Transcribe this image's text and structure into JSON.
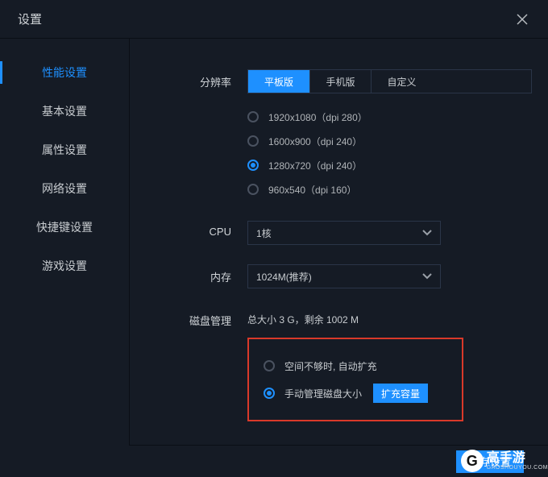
{
  "header": {
    "title": "设置"
  },
  "sidebar": {
    "items": [
      {
        "label": "性能设置",
        "active": true
      },
      {
        "label": "基本设置",
        "active": false
      },
      {
        "label": "属性设置",
        "active": false
      },
      {
        "label": "网络设置",
        "active": false
      },
      {
        "label": "快捷键设置",
        "active": false
      },
      {
        "label": "游戏设置",
        "active": false
      }
    ]
  },
  "resolution": {
    "label": "分辨率",
    "modes": [
      {
        "label": "平板版",
        "active": true
      },
      {
        "label": "手机版",
        "active": false
      },
      {
        "label": "自定义",
        "active": false
      }
    ],
    "options": [
      {
        "label": "1920x1080（dpi 280）",
        "selected": false
      },
      {
        "label": "1600x900（dpi 240）",
        "selected": false
      },
      {
        "label": "1280x720（dpi 240）",
        "selected": true
      },
      {
        "label": "960x540（dpi 160）",
        "selected": false
      }
    ]
  },
  "cpu": {
    "label": "CPU",
    "value": "1核"
  },
  "memory": {
    "label": "内存",
    "value": "1024M(推荐)"
  },
  "disk": {
    "label": "磁盘管理",
    "info": "总大小 3 G，剩余 1002 M",
    "options": [
      {
        "label": "空间不够时, 自动扩充",
        "selected": false
      },
      {
        "label": "手动管理磁盘大小",
        "selected": true
      }
    ],
    "expand_btn": "扩充容量"
  },
  "footer": {
    "save": "保存设置"
  },
  "watermark": {
    "glyph": "G",
    "main": "高手游",
    "sub": "GAOSHOUYOU.COM"
  }
}
